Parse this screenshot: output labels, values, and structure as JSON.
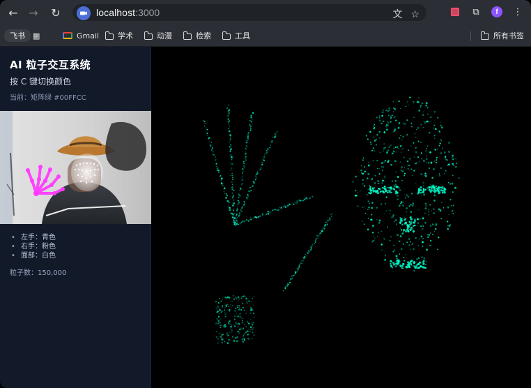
{
  "browser": {
    "url_host": "localhost",
    "url_port": ":3000"
  },
  "bookmarks": {
    "feishu": "飞书",
    "gmail": "Gmail",
    "academic": "学术",
    "anime": "动漫",
    "search": "检索",
    "tools": "工具",
    "all_bookmarks": "所有书签"
  },
  "panel": {
    "title": "AI 粒子交互系统",
    "subtitle": "按 C 键切换颜色",
    "current": "当前：矩阵绿 #00FFCC",
    "legend": [
      "左手：青色",
      "右手：粉色",
      "面部：白色"
    ],
    "particle_count": "粒子数：150,000"
  },
  "theme": {
    "particle": "#00FFCC",
    "accent_purple": "#8c55ff"
  },
  "profile": {
    "initial": "f"
  }
}
